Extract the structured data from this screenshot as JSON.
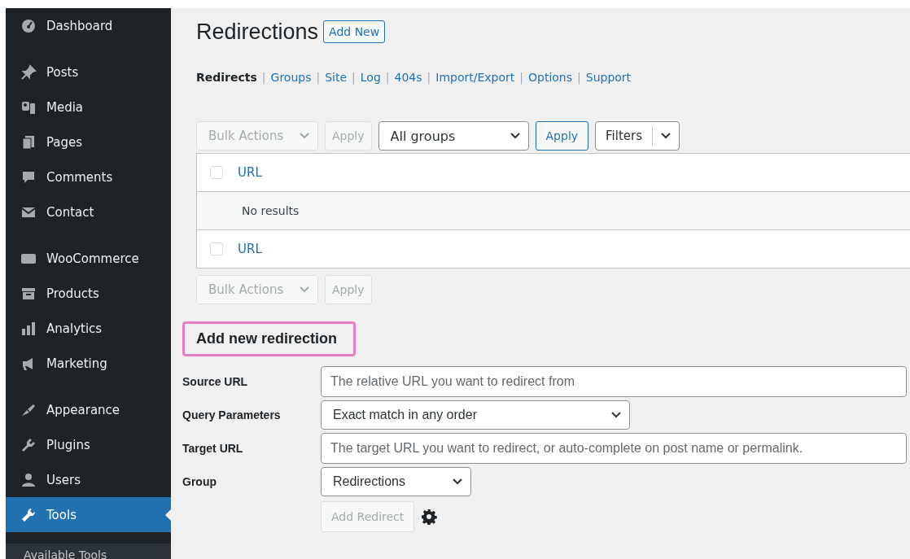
{
  "sidebar": {
    "groups": [
      {
        "items": [
          {
            "label": "Dashboard",
            "selected": false
          }
        ]
      },
      {
        "items": [
          {
            "label": "Posts",
            "selected": false
          },
          {
            "label": "Media",
            "selected": false
          },
          {
            "label": "Pages",
            "selected": false
          },
          {
            "label": "Comments",
            "selected": false
          },
          {
            "label": "Contact",
            "selected": false
          }
        ]
      },
      {
        "items": [
          {
            "label": "WooCommerce",
            "selected": false
          },
          {
            "label": "Products",
            "selected": false
          },
          {
            "label": "Analytics",
            "selected": false
          },
          {
            "label": "Marketing",
            "selected": false
          }
        ]
      },
      {
        "items": [
          {
            "label": "Appearance",
            "selected": false
          },
          {
            "label": "Plugins",
            "selected": false
          },
          {
            "label": "Users",
            "selected": false
          },
          {
            "label": "Tools",
            "selected": true
          }
        ]
      }
    ],
    "submenu": [
      "Available Tools"
    ]
  },
  "page": {
    "title": "Redirections",
    "add_new": "Add New"
  },
  "subnav": [
    {
      "label": "Redirects",
      "selected": true
    },
    {
      "separator": "|",
      "label": "Groups",
      "selected": false
    },
    {
      "separator": "|",
      "label": "Site",
      "selected": false
    },
    {
      "separator": "|",
      "label": "Log",
      "selected": false
    },
    {
      "separator": "|",
      "label": "404s",
      "selected": false
    },
    {
      "separator": "|",
      "label": "Import/Export",
      "selected": false
    },
    {
      "separator": "|",
      "label": "Options",
      "selected": false
    },
    {
      "separator": "|",
      "label": "Support",
      "selected": false
    }
  ],
  "top_toolbar": {
    "bulk_actions": {
      "label": "Bulk Actions",
      "disabled": true
    },
    "bulk_apply": {
      "label": "Apply",
      "disabled": true
    },
    "group_select": {
      "value": "All groups"
    },
    "group_apply": {
      "label": "Apply",
      "disabled": false
    },
    "filters": {
      "label": "Filters"
    }
  },
  "table": {
    "header": {
      "column": "URL",
      "checked": false
    },
    "empty_message": "No results",
    "footer": {
      "column": "URL",
      "checked": false
    }
  },
  "bottom_toolbar": {
    "bulk_actions": {
      "label": "Bulk Actions",
      "disabled": true
    },
    "bulk_apply": {
      "label": "Apply",
      "disabled": true
    }
  },
  "form": {
    "title": "Add new redirection",
    "fields": [
      {
        "kind": "text",
        "label": "Source URL",
        "placeholder": "The relative URL you want to redirect from"
      },
      {
        "kind": "select",
        "label": "Query Parameters",
        "value": "Exact match in any order"
      },
      {
        "kind": "text",
        "label": "Target URL",
        "placeholder": "The target URL you want to redirect, or auto-complete on post name or permalink."
      },
      {
        "kind": "select",
        "label": "Group",
        "value": "Redirections"
      }
    ],
    "submit": {
      "label": "Add Redirect",
      "disabled": true
    }
  }
}
